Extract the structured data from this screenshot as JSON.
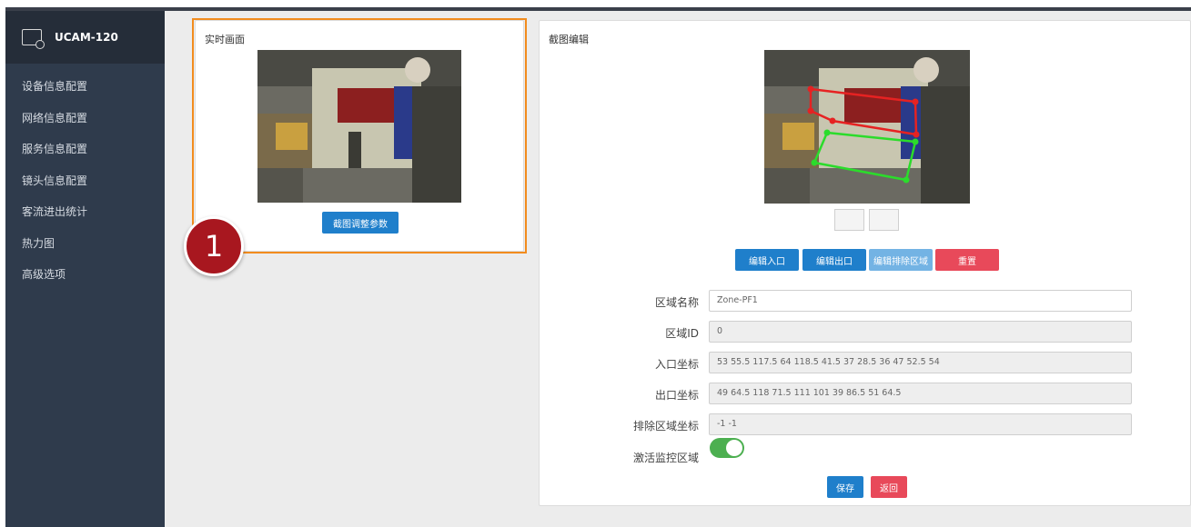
{
  "sidebar": {
    "brand_title": "UCAM-120",
    "items": [
      {
        "label": "设备信息配置"
      },
      {
        "label": "网络信息配置"
      },
      {
        "label": "服务信息配置"
      },
      {
        "label": "镜头信息配置"
      },
      {
        "label": "客流进出统计"
      },
      {
        "label": "热力图"
      },
      {
        "label": "高级选项"
      }
    ]
  },
  "live_panel": {
    "title": "实时画面",
    "adjust_button": "截图调整参数"
  },
  "edit_panel": {
    "title": "截图编辑",
    "buttons": {
      "edit_entry": "编辑入口",
      "edit_exit": "编辑出口",
      "edit_exclude": "编辑排除区域",
      "reset": "重置"
    },
    "form": {
      "zone_name_label": "区域名称",
      "zone_name_value": "Zone-PF1",
      "zone_id_label": "区域ID",
      "zone_id_value": "0",
      "entry_label": "入口坐标",
      "entry_value": "53 55.5 117.5 64 118.5 41.5 37 28.5 36 47 52.5 54",
      "exit_label": "出口坐标",
      "exit_value": "49 64.5 118 71.5 111 101 39 86.5 51 64.5",
      "exclude_label": "排除区域坐标",
      "exclude_value": "-1 -1",
      "activate_label": "激活监控区域",
      "activate_on": true
    },
    "save_button": "保存",
    "back_button": "返回"
  },
  "step_badge": "1",
  "colors": {
    "sidebar_bg": "#2f3b4c",
    "primary_blue": "#1f7fcb",
    "danger_red": "#e8495a",
    "toggle_green": "#4caf50",
    "highlight_orange": "#f28c1e",
    "entry_zone": "#e62222",
    "exit_zone": "#2bdc2b"
  }
}
